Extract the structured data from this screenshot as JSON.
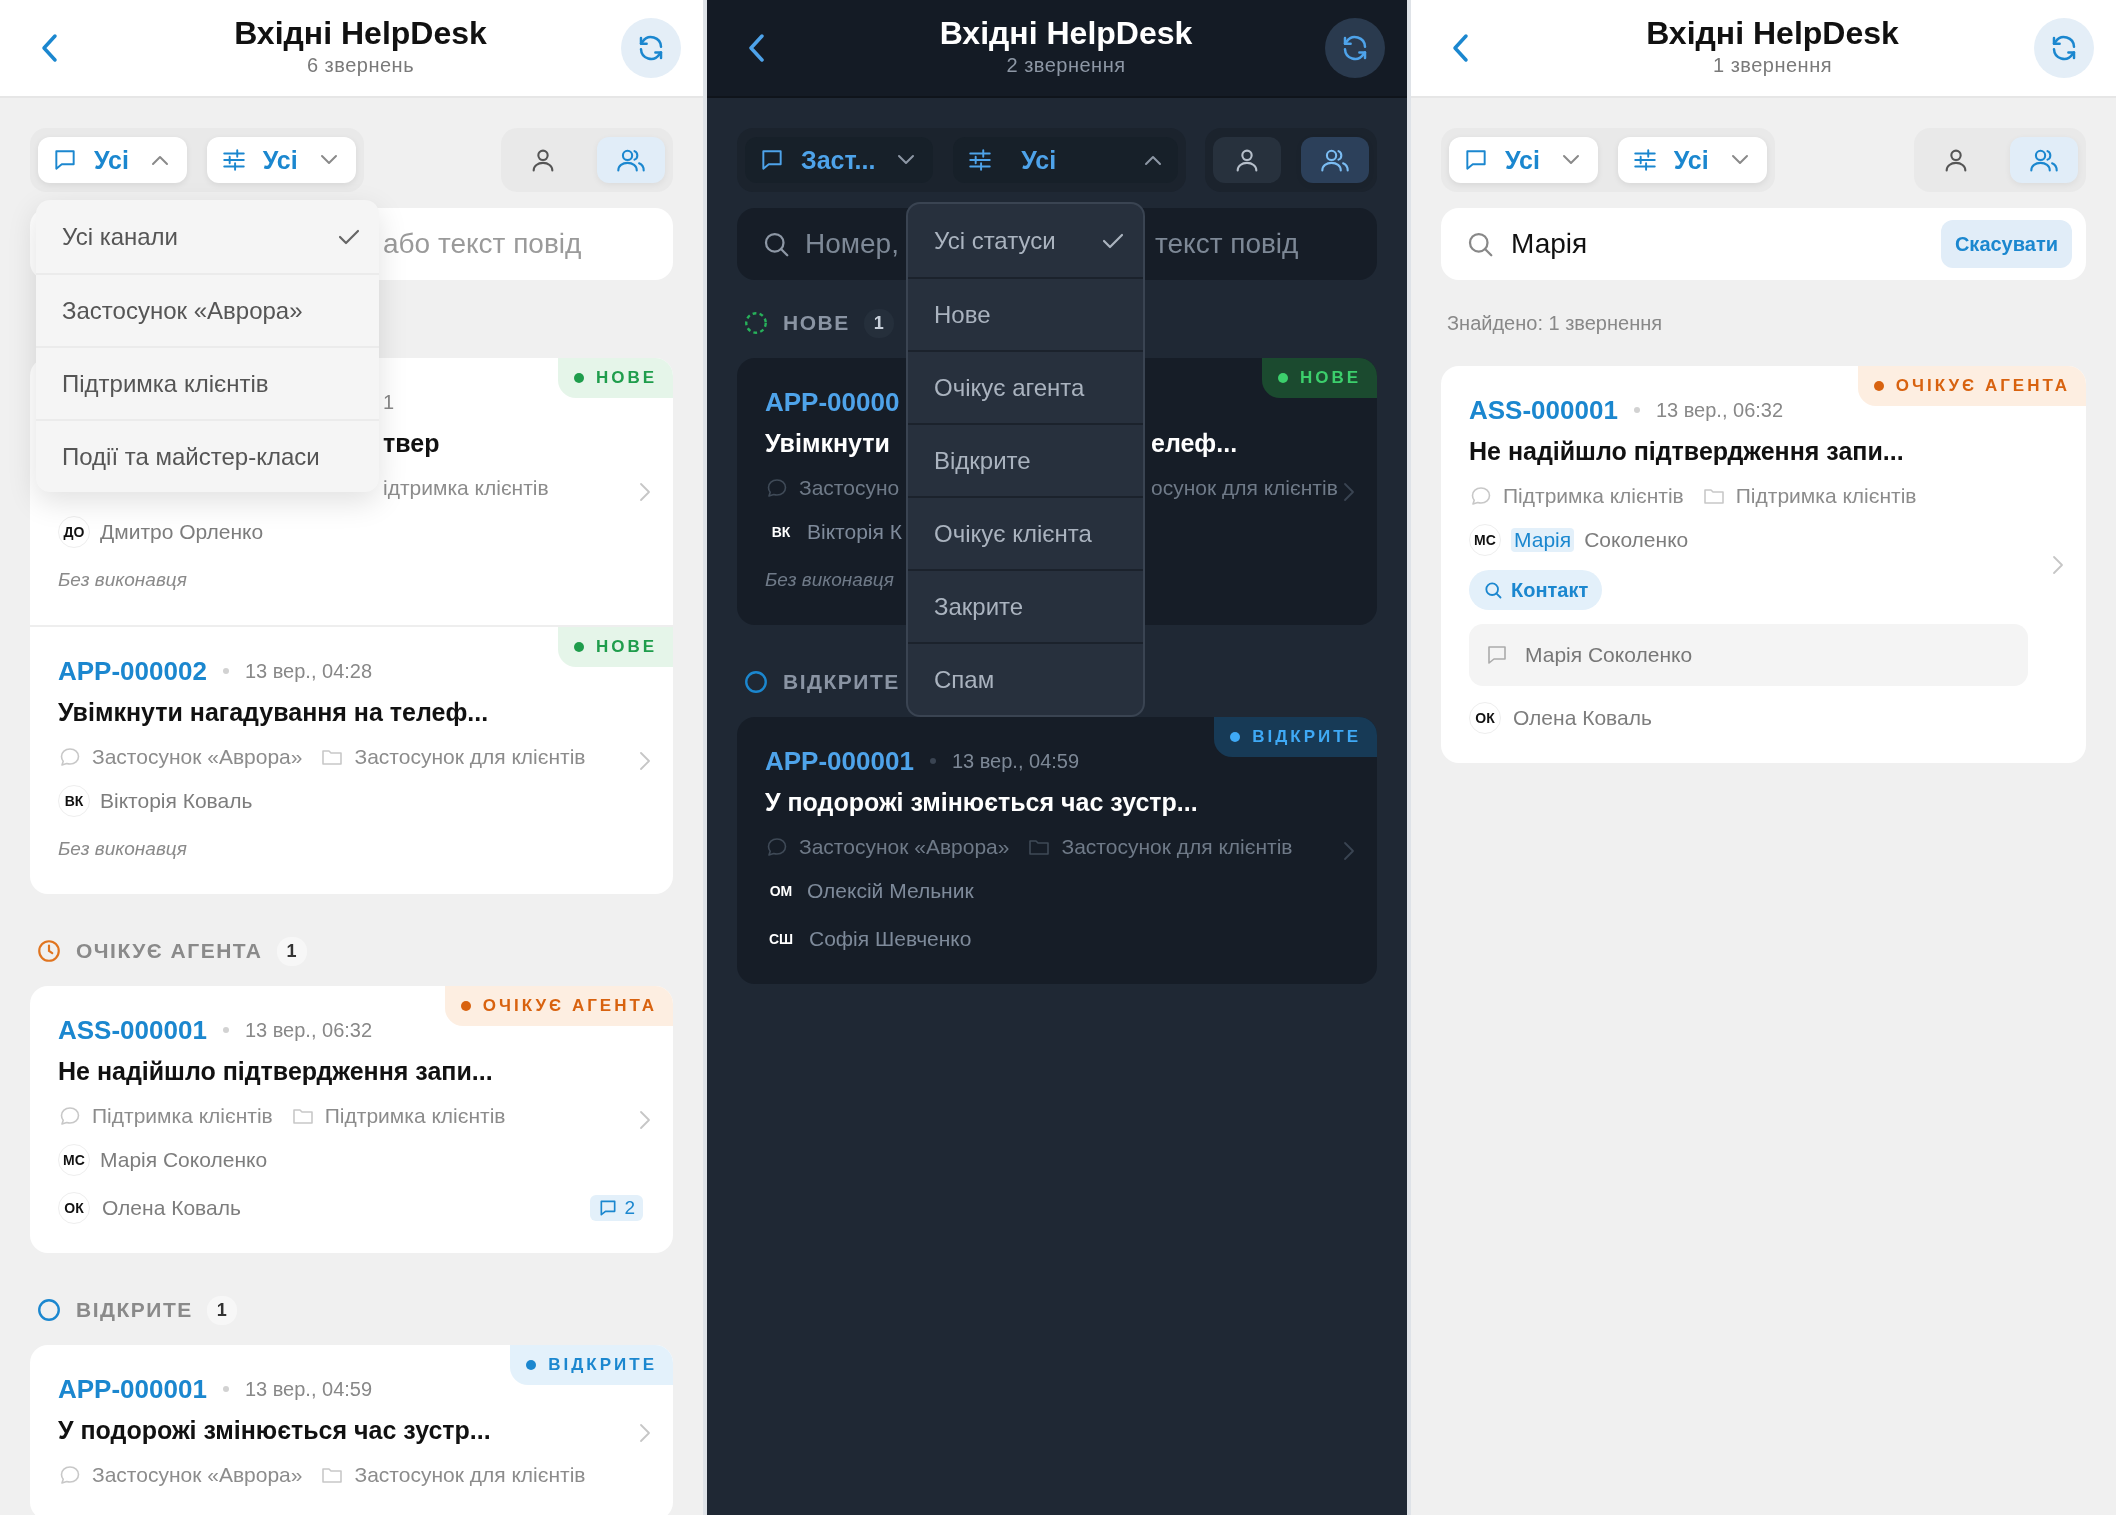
{
  "panels": [
    {
      "kind": "light",
      "title": "Вхідні HelpDesk",
      "subtitle": "6 звернень",
      "filters": [
        {
          "kind": "channel",
          "label": "Усі",
          "expanded": true,
          "options": [
            {
              "label": "Усі канали",
              "selected": true
            },
            {
              "label": "Застосунок «Аврора»",
              "selected": false
            },
            {
              "label": "Підтримка клієнтів",
              "selected": false
            },
            {
              "label": "Події та майстер-класи",
              "selected": false
            }
          ]
        },
        {
          "kind": "status",
          "label": "Усі",
          "expanded": false
        }
      ],
      "views": [
        {
          "kind": "mine",
          "selected": false
        },
        {
          "kind": "team",
          "selected": true
        }
      ],
      "search": {
        "placeholder": {
          "after": "або текст повід"
        }
      },
      "sections": [
        {
          "tickets": [
            {
              "kind": "new",
              "badge": "НОВЕ",
              "date": {
                "after": "1"
              },
              "title": {
                "after": "твер"
              },
              "folder": {
                "after": "ідтримка клієнтів"
              },
              "customer": {
                "initials": "ДО",
                "name": "Дмитро Орленко"
              },
              "unassigned": "Без виконавця"
            },
            {
              "kind": "new",
              "badge": "НОВЕ",
              "id": "APP-000002",
              "date": "13 вер., 04:28",
              "title": "Увімкнути нагадування на телеф...",
              "channel": "Застосунок «Аврора»",
              "folder": "Застосунок для клієнтів",
              "customer": {
                "initials": "ВК",
                "name": "Вікторія Коваль"
              },
              "unassigned": "Без виконавця"
            }
          ]
        },
        {
          "kind": "waiting",
          "label": "ОЧІКУЄ АГЕНТА",
          "count": "1",
          "tickets": [
            {
              "kind": "waiting",
              "badge": "ОЧІКУЄ АГЕНТА",
              "id": "ASS-000001",
              "date": "13 вер., 06:32",
              "title": "Не надійшло підтвердження запи...",
              "channel": "Підтримка клієнтів",
              "folder": "Підтримка клієнтів",
              "customer": {
                "initials": "МС",
                "name": "Марія Соколенко"
              },
              "assignee": {
                "initials": "ОК",
                "name": "Олена Коваль"
              },
              "comments": "2"
            }
          ]
        },
        {
          "kind": "open",
          "label": "ВІДКРИТЕ",
          "count": "1",
          "tickets": [
            {
              "kind": "open",
              "badge": "ВІДКРИТЕ",
              "id": "APP-000001",
              "date": "13 вер., 04:59",
              "title": "У подорожі змінюється час зустр...",
              "channel": "Застосунок «Аврора»",
              "folder": "Застосунок для клієнтів"
            }
          ]
        }
      ]
    },
    {
      "kind": "dark",
      "title": "Вхідні HelpDesk",
      "subtitle": "2 звернення",
      "filters": [
        {
          "kind": "channel",
          "label": "Заст...",
          "expanded": false
        },
        {
          "kind": "status",
          "label": "Усі",
          "expanded": true,
          "options": [
            {
              "label": "Усі статуси",
              "selected": true
            },
            {
              "label": "Нове",
              "selected": false
            },
            {
              "label": "Очікує агента",
              "selected": false
            },
            {
              "label": "Відкрите",
              "selected": false
            },
            {
              "label": "Очікує клієнта",
              "selected": false
            },
            {
              "label": "Закрите",
              "selected": false
            },
            {
              "label": "Спам",
              "selected": false
            }
          ]
        }
      ],
      "views": [
        {
          "kind": "mine",
          "selected": false
        },
        {
          "kind": "team",
          "selected": true
        }
      ],
      "search": {
        "placeholder": {
          "before": "Номер,",
          "after": "текст повід"
        }
      },
      "sections": [
        {
          "kind": "new",
          "label": "НОВЕ",
          "count": "1",
          "tickets": [
            {
              "kind": "new",
              "badge": "НОВЕ",
              "id": "APP-00000",
              "title": {
                "before": "Увімкнути",
                "after": "елеф..."
              },
              "channel": "Застосуно",
              "folder": {
                "after": "осунок для клієнтів"
              },
              "customer": {
                "initials": "ВК",
                "name": "Вікторія К"
              },
              "unassigned": "Без виконавця"
            }
          ]
        },
        {
          "kind": "open",
          "label": "ВІДКРИТЕ",
          "tickets": [
            {
              "kind": "open",
              "badge": "ВІДКРИТЕ",
              "id": "APP-000001",
              "date": "13 вер., 04:59",
              "title": "У подорожі змінюється час зустр...",
              "channel": "Застосунок «Аврора»",
              "folder": "Застосунок для клієнтів",
              "customer": {
                "initials": "ОМ",
                "name": "Олексій Мельник"
              },
              "assignee": {
                "initials": "СШ",
                "name": "Софія Шевченко"
              }
            }
          ]
        }
      ]
    },
    {
      "kind": "light",
      "title": "Вхідні HelpDesk",
      "subtitle": "1 звернення",
      "filters": [
        {
          "kind": "channel",
          "label": "Усі",
          "expanded": false
        },
        {
          "kind": "status",
          "label": "Усі",
          "expanded": false
        }
      ],
      "views": [
        {
          "kind": "mine",
          "selected": false
        },
        {
          "kind": "team",
          "selected": true
        }
      ],
      "search": {
        "value": "Марія",
        "cancel": "Скасувати"
      },
      "results_note": "Знайдено: 1 звернення",
      "sections": [
        {
          "tickets": [
            {
              "kind": "waiting",
              "badge": "ОЧІКУЄ АГЕНТА",
              "id": "ASS-000001",
              "date": "13 вер., 06:32",
              "title": "Не надійшло підтвердження запи...",
              "channel": "Підтримка клієнтів",
              "folder": "Підтримка клієнтів",
              "customer": {
                "initials": "МС",
                "name_parts": [
                  {
                    "text": "Марія",
                    "highlighted": true
                  },
                  {
                    "text": "Соколенко",
                    "highlighted": false
                  }
                ]
              },
              "match_chip": "Контакт",
              "matched_message": "Марія Соколенко",
              "assignee": {
                "initials": "ОК",
                "name": "Олена Коваль"
              }
            }
          ]
        }
      ]
    }
  ]
}
